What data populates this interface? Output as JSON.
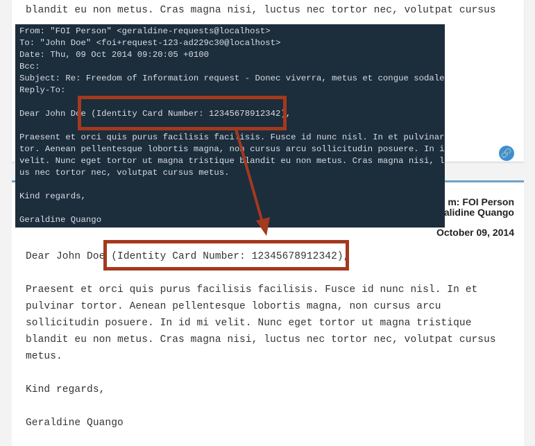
{
  "top_card": {
    "line": "blandit eu non metus. Cras magna nisi, luctus nec tortor nec, volutpat cursus"
  },
  "message_meta": {
    "from_partial": "m: FOI Person",
    "name_partial": "ralidine Quango",
    "date": "October 09, 2014"
  },
  "message_body": {
    "greeting_prefix": "Dear John Doe ",
    "identity": "(Identity Card Number: 12345678912342),",
    "para_lines": [
      "Praesent et orci quis purus facilisis facilisis. Fusce id nunc nisl. In et",
      "pulvinar tortor. Aenean pellentesque lobortis magna, non cursus arcu",
      "sollicitudin posuere. In id mi velit. Nunc eget tortor ut magna tristique",
      "blandit eu non metus. Cras magna nisi, luctus nec tortor nec, volutpat cursus",
      "metus."
    ],
    "closing": "Kind regards,",
    "signature": "Geraldine Quango"
  },
  "raw_email": {
    "lines": [
      "From: \"FOI Person\" <geraldine-requests@localhost>",
      "To: \"John Doe\" <foi+request-123-ad229c30@localhost>",
      "Date: Thu, 09 Oct 2014 09:20:05 +0100",
      "Bcc:",
      "Subject: Re: Freedom of Information request - Donec viverra, metus et congue sodales",
      "Reply-To:",
      "",
      "Dear John Doe (Identity Card Number: 12345678912342),",
      "",
      "Praesent et orci quis purus facilisis facilisis. Fusce id nunc nisl. In et pulvinar tor",
      "tor. Aenean pellentesque lobortis magna, non cursus arcu sollicitudin posuere. In id mi",
      " velit. Nunc eget tortor ut magna tristique blandit eu non metus. Cras magna nisi, luct",
      "us nec tortor nec, volutpat cursus metus.",
      "",
      "Kind regards,",
      "",
      "Geraldine Quango"
    ]
  },
  "icons": {
    "link": "link-icon"
  },
  "colors": {
    "highlight": "#a4391e",
    "terminal_bg": "#1c2d3c",
    "accent": "#3d8fcf"
  }
}
